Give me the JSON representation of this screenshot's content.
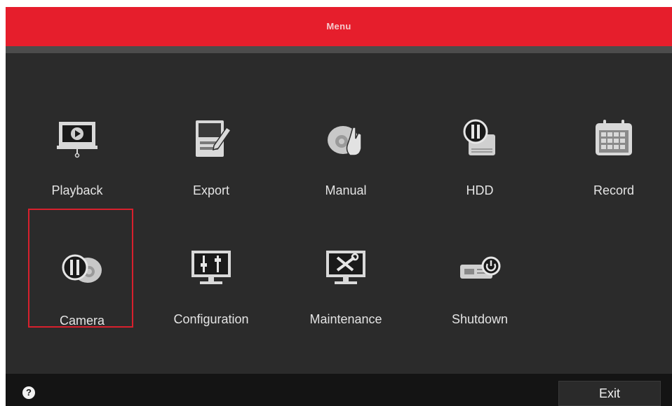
{
  "window": {
    "title": "Menu"
  },
  "menu": {
    "items": [
      {
        "label": "Playback",
        "icon": "playback-icon"
      },
      {
        "label": "Export",
        "icon": "export-icon"
      },
      {
        "label": "Manual",
        "icon": "manual-icon"
      },
      {
        "label": "HDD",
        "icon": "hdd-icon"
      },
      {
        "label": "Record",
        "icon": "record-icon"
      },
      {
        "label": "Camera",
        "icon": "camera-icon",
        "selected": true
      },
      {
        "label": "Configuration",
        "icon": "configuration-icon"
      },
      {
        "label": "Maintenance",
        "icon": "maintenance-icon"
      },
      {
        "label": "Shutdown",
        "icon": "shutdown-icon"
      }
    ]
  },
  "footer": {
    "help_icon": "question-icon",
    "help_glyph": "?",
    "exit_label": "Exit"
  },
  "colors": {
    "title_bar": "#e61e2c",
    "background": "#2b2b2b",
    "footer": "#141414",
    "selection": "#d8202d"
  }
}
